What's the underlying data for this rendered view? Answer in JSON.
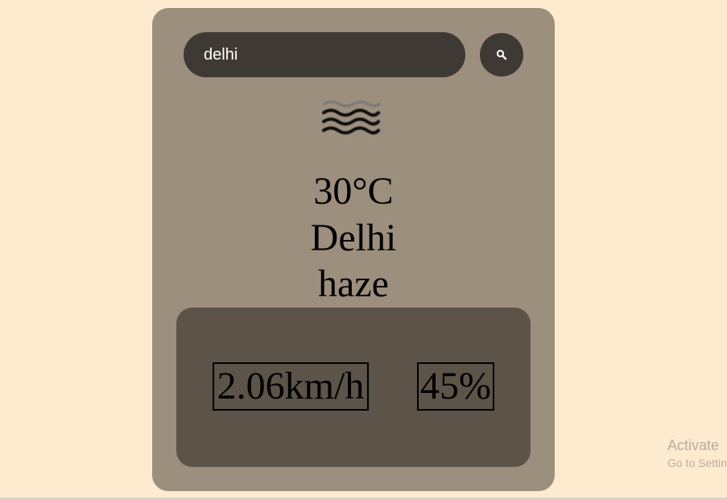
{
  "search": {
    "value": "delhi",
    "button_icon": "search-icon"
  },
  "weather": {
    "icon": "haze-icon",
    "temperature": "30°C",
    "city": "Delhi",
    "description": "haze"
  },
  "details": {
    "wind_speed": "2.06km/h",
    "humidity": "45%"
  },
  "watermark": {
    "title": "Activate",
    "subtitle": "Go to Settings"
  },
  "colors": {
    "page_background": "#FEEBCF",
    "card_background": "#9C8F7E",
    "input_background": "#3E3934",
    "details_background": "#5C5349"
  }
}
